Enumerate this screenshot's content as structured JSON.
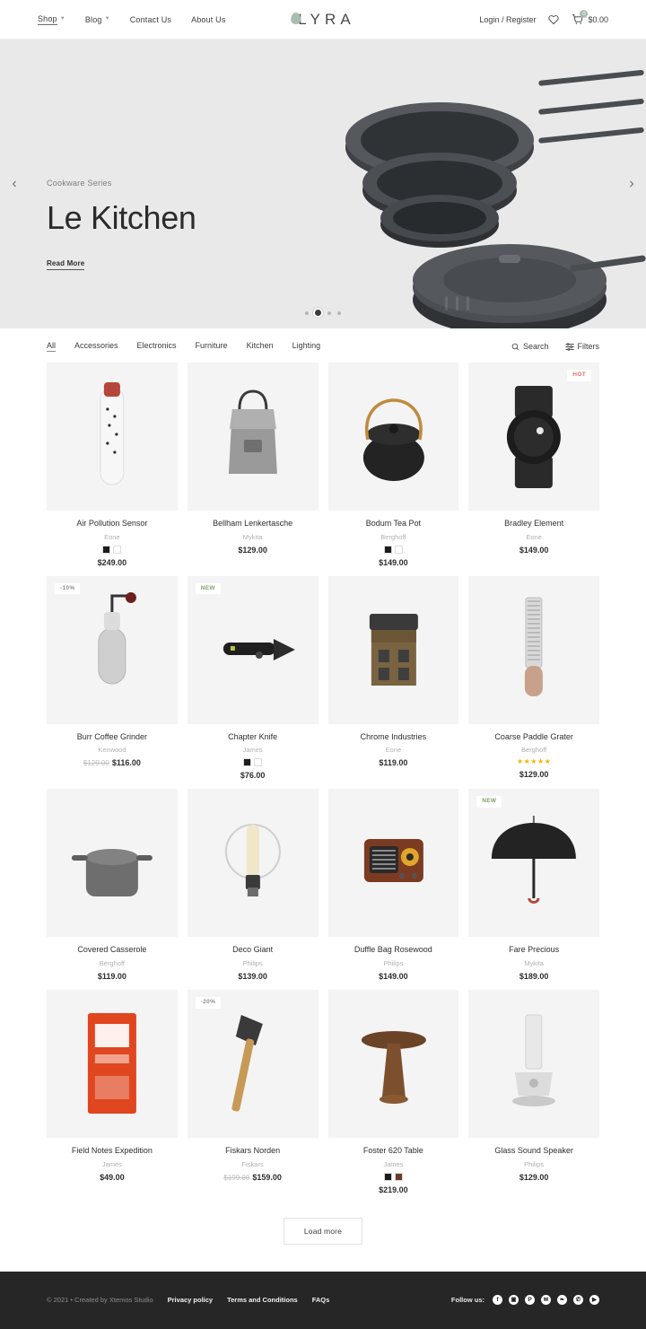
{
  "header": {
    "nav": [
      {
        "label": "Shop",
        "has_caret": true,
        "active": true
      },
      {
        "label": "Blog",
        "has_caret": true,
        "active": false
      },
      {
        "label": "Contact Us",
        "has_caret": false,
        "active": false
      },
      {
        "label": "About Us",
        "has_caret": false,
        "active": false
      }
    ],
    "logo": "LYRA",
    "logo_mark_color": "#a9bcb0",
    "login_label": "Login / Register",
    "wishlist_icon": "heart-icon",
    "cart_icon": "cart-icon",
    "cart_count": "0",
    "cart_total": "$0.00"
  },
  "hero": {
    "kicker": "Cookware Series",
    "title": "Le Kitchen",
    "cta": "Read More",
    "prev_arrow": "‹",
    "next_arrow": "›",
    "dots": 4,
    "active_dot": 1,
    "bg_color": "#e9e9e9"
  },
  "filterbar": {
    "categories": [
      {
        "label": "All",
        "active": true
      },
      {
        "label": "Accessories",
        "active": false
      },
      {
        "label": "Electronics",
        "active": false
      },
      {
        "label": "Furniture",
        "active": false
      },
      {
        "label": "Kitchen",
        "active": false
      },
      {
        "label": "Lighting",
        "active": false
      }
    ],
    "search_label": "Search",
    "filters_label": "Filters"
  },
  "products": [
    {
      "title": "Air Pollution Sensor",
      "brand": "Eone",
      "price": "$249.00",
      "old_price": "",
      "badge": "",
      "badge_type": "",
      "swatches": [
        "#1c1c1c",
        "#ffffff"
      ],
      "rating": 0
    },
    {
      "title": "Bellham Lenkertasche",
      "brand": "Mykita",
      "price": "$129.00",
      "old_price": "",
      "badge": "",
      "badge_type": "",
      "swatches": [],
      "rating": 0
    },
    {
      "title": "Bodum Tea Pot",
      "brand": "Berghoff",
      "price": "$149.00",
      "old_price": "",
      "badge": "",
      "badge_type": "",
      "swatches": [
        "#1c1c1c",
        "#ffffff"
      ],
      "rating": 0
    },
    {
      "title": "Bradley Element",
      "brand": "Eone",
      "price": "$149.00",
      "old_price": "",
      "badge": "HOT",
      "badge_type": "hot",
      "swatches": [],
      "rating": 0
    },
    {
      "title": "Burr Coffee Grinder",
      "brand": "Kenwood",
      "price": "$116.00",
      "old_price": "$129.00",
      "badge": "-10%",
      "badge_type": "sale",
      "swatches": [],
      "rating": 0
    },
    {
      "title": "Chapter Knife",
      "brand": "James",
      "price": "$76.00",
      "old_price": "",
      "badge": "NEW",
      "badge_type": "new",
      "swatches": [
        "#1c1c1c",
        "#ffffff"
      ],
      "rating": 0
    },
    {
      "title": "Chrome Industries",
      "brand": "Eone",
      "price": "$119.00",
      "old_price": "",
      "badge": "",
      "badge_type": "",
      "swatches": [],
      "rating": 0
    },
    {
      "title": "Coarse Paddle Grater",
      "brand": "Berghoff",
      "price": "$129.00",
      "old_price": "",
      "badge": "",
      "badge_type": "",
      "swatches": [],
      "rating": 5
    },
    {
      "title": "Covered Casserole",
      "brand": "Berghoff",
      "price": "$119.00",
      "old_price": "",
      "badge": "",
      "badge_type": "",
      "swatches": [],
      "rating": 0
    },
    {
      "title": "Deco Giant",
      "brand": "Philips",
      "price": "$139.00",
      "old_price": "",
      "badge": "",
      "badge_type": "",
      "swatches": [],
      "rating": 0
    },
    {
      "title": "Duffle Bag Rosewood",
      "brand": "Philips",
      "price": "$149.00",
      "old_price": "",
      "badge": "",
      "badge_type": "",
      "swatches": [],
      "rating": 0
    },
    {
      "title": "Fare Precious",
      "brand": "Mykita",
      "price": "$189.00",
      "old_price": "",
      "badge": "NEW",
      "badge_type": "new",
      "swatches": [],
      "rating": 0
    },
    {
      "title": "Field Notes Expedition",
      "brand": "James",
      "price": "$49.00",
      "old_price": "",
      "badge": "",
      "badge_type": "",
      "swatches": [],
      "rating": 0
    },
    {
      "title": "Fiskars Norden",
      "brand": "Fiskars",
      "price": "$159.00",
      "old_price": "$199.00",
      "badge": "-20%",
      "badge_type": "sale",
      "swatches": [],
      "rating": 0
    },
    {
      "title": "Foster 620 Table",
      "brand": "James",
      "price": "$219.00",
      "old_price": "",
      "badge": "",
      "badge_type": "",
      "swatches": [
        "#1c1c1c",
        "#6b3b2b"
      ],
      "rating": 0
    },
    {
      "title": "Glass Sound Speaker",
      "brand": "Philips",
      "price": "$129.00",
      "old_price": "",
      "badge": "",
      "badge_type": "",
      "swatches": [],
      "rating": 0
    }
  ],
  "load_more": "Load more",
  "footer": {
    "copyright": "© 2021 • Created by Xtemos Studio",
    "links": [
      "Privacy policy",
      "Terms and Conditions",
      "FAQs"
    ],
    "follow_label": "Follow us:",
    "socials": [
      {
        "name": "facebook-icon",
        "glyph": "f"
      },
      {
        "name": "instagram-icon",
        "glyph": "▣"
      },
      {
        "name": "pinterest-icon",
        "glyph": "P"
      },
      {
        "name": "email-icon",
        "glyph": "✉"
      },
      {
        "name": "twitter-icon",
        "glyph": "❧"
      },
      {
        "name": "whatsapp-icon",
        "glyph": "✆"
      },
      {
        "name": "youtube-icon",
        "glyph": "▶"
      }
    ]
  }
}
